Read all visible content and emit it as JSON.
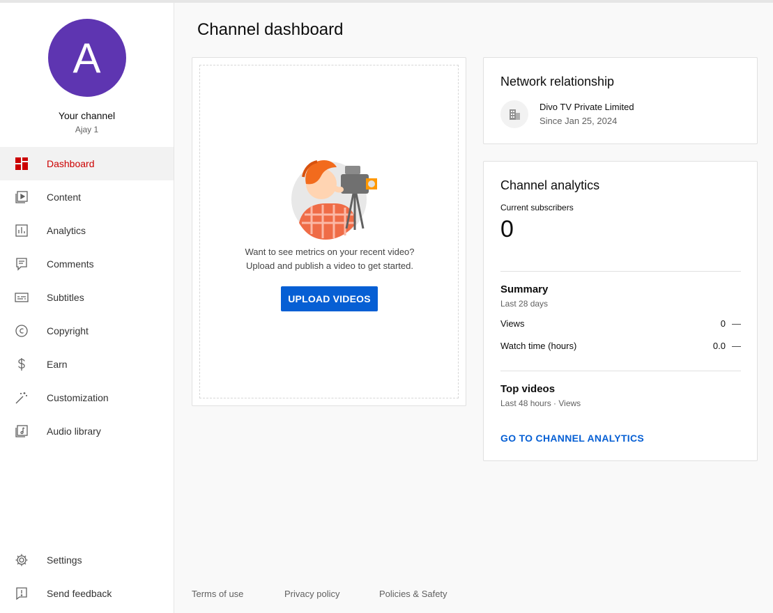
{
  "channel": {
    "avatar_letter": "A",
    "title": "Your channel",
    "subtitle": "Ajay 1"
  },
  "nav": {
    "items": [
      {
        "label": "Dashboard",
        "icon": "dashboard-icon",
        "active": true
      },
      {
        "label": "Content",
        "icon": "content-icon"
      },
      {
        "label": "Analytics",
        "icon": "analytics-icon"
      },
      {
        "label": "Comments",
        "icon": "comments-icon"
      },
      {
        "label": "Subtitles",
        "icon": "subtitles-icon"
      },
      {
        "label": "Copyright",
        "icon": "copyright-icon"
      },
      {
        "label": "Earn",
        "icon": "dollar-icon"
      },
      {
        "label": "Customization",
        "icon": "magic-wand-icon"
      },
      {
        "label": "Audio library",
        "icon": "audio-library-icon"
      }
    ],
    "bottom": [
      {
        "label": "Settings",
        "icon": "gear-icon"
      },
      {
        "label": "Send feedback",
        "icon": "feedback-icon"
      }
    ]
  },
  "page_title": "Channel dashboard",
  "upload_card": {
    "line1": "Want to see metrics on your recent video?",
    "line2": "Upload and publish a video to get started.",
    "button": "UPLOAD VIDEOS"
  },
  "network": {
    "title": "Network relationship",
    "name": "Divo TV Private Limited",
    "since": "Since Jan 25, 2024"
  },
  "analytics": {
    "title": "Channel analytics",
    "subscribers_label": "Current subscribers",
    "subscribers_value": "0",
    "summary_title": "Summary",
    "summary_period": "Last 28 days",
    "views_label": "Views",
    "views_value": "0",
    "watch_label": "Watch time (hours)",
    "watch_value": "0.0",
    "trend": "—",
    "top_title": "Top videos",
    "top_period": "Last 48 hours · Views",
    "link": "GO TO CHANNEL ANALYTICS"
  },
  "footer": {
    "terms": "Terms of use",
    "privacy": "Privacy policy",
    "policies": "Policies & Safety"
  },
  "colors": {
    "accent_red": "#cc0000",
    "brand_blue": "#065fd4",
    "avatar_purple": "#5e35b1"
  }
}
